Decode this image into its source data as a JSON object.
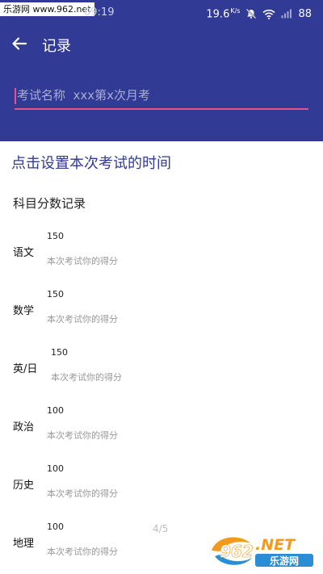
{
  "status_bar": {
    "watermark": "乐游网 www.962.net",
    "time": "09:19",
    "speed": "19.6",
    "speed_unit": "K/s",
    "battery": "88"
  },
  "toolbar": {
    "back_icon": "arrow-left-icon",
    "title": "记录"
  },
  "exam": {
    "name_placeholder": "考试名称  xxx第x次月考",
    "set_time_label": "点击设置本次考试的时间"
  },
  "scores": {
    "section_title": "科目分数记录",
    "score_placeholder": "本次考试你的得分",
    "subjects": [
      {
        "name": "语文",
        "full_score": "150"
      },
      {
        "name": "数学",
        "full_score": "150"
      },
      {
        "name": "英/日",
        "full_score": "150"
      },
      {
        "name": "政治",
        "full_score": "100"
      },
      {
        "name": "历史",
        "full_score": "100"
      },
      {
        "name": "地理",
        "full_score": "100"
      }
    ]
  },
  "page_indicator": "4/5",
  "watermark_bottom": {
    "logo": "962.NET",
    "text": "乐游网"
  },
  "colors": {
    "primary": "#313a94",
    "accent": "#e8518a"
  }
}
